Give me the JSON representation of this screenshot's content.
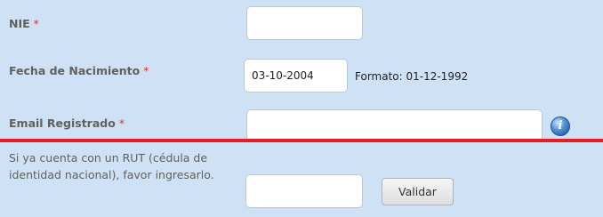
{
  "form": {
    "nie": {
      "label": "NIE",
      "required_mark": "*",
      "value": ""
    },
    "fecha": {
      "label": "Fecha de Nacimiento",
      "required_mark": "*",
      "value": "03-10-2004",
      "hint": "Formato: 01-12-1992"
    },
    "email": {
      "label": "Email Registrado",
      "required_mark": "*",
      "value": "",
      "info_icon": "info-icon"
    },
    "rut": {
      "label": "Si ya cuenta con un RUT (cédula de identidad nacional), favor ingresarlo.",
      "value": "",
      "button_label": "Validar"
    }
  },
  "colors": {
    "background": "#cfe2f5",
    "divider": "#e31e24",
    "required": "#e03030"
  }
}
